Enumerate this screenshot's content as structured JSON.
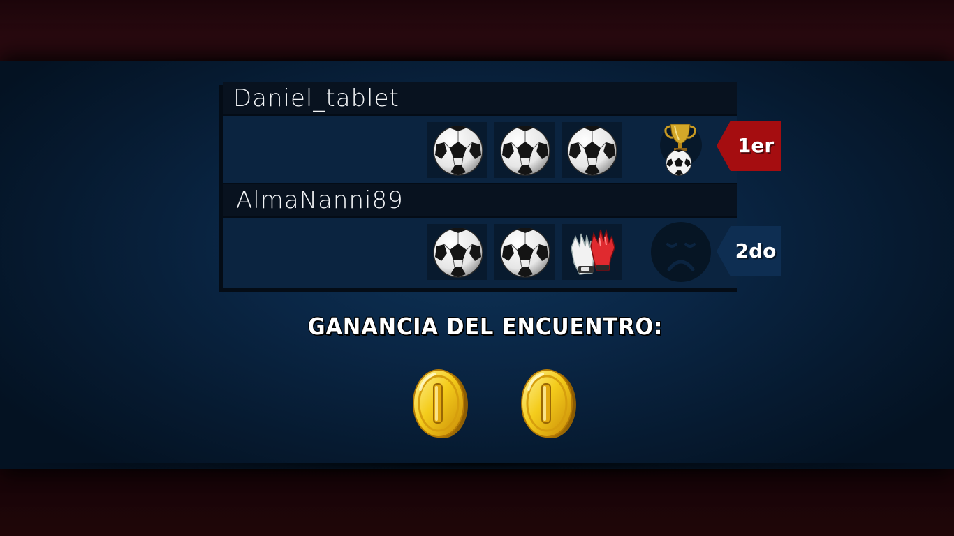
{
  "results": {
    "players": [
      {
        "name": "Daniel_tablet",
        "slots": [
          "soccer-ball",
          "soccer-ball",
          "soccer-ball"
        ],
        "status_icon": "trophy-ball-icon",
        "place": "1er",
        "place_color": "#a50d10"
      },
      {
        "name": "AlmaNanni89",
        "slots": [
          "soccer-ball",
          "soccer-ball",
          "goalkeeper-gloves"
        ],
        "status_icon": "sad-face-icon",
        "place": "2do",
        "place_color": "#0e2e52"
      }
    ]
  },
  "earnings": {
    "title": "GANANCIA DEL ENCUENTRO:",
    "coins": 2
  }
}
